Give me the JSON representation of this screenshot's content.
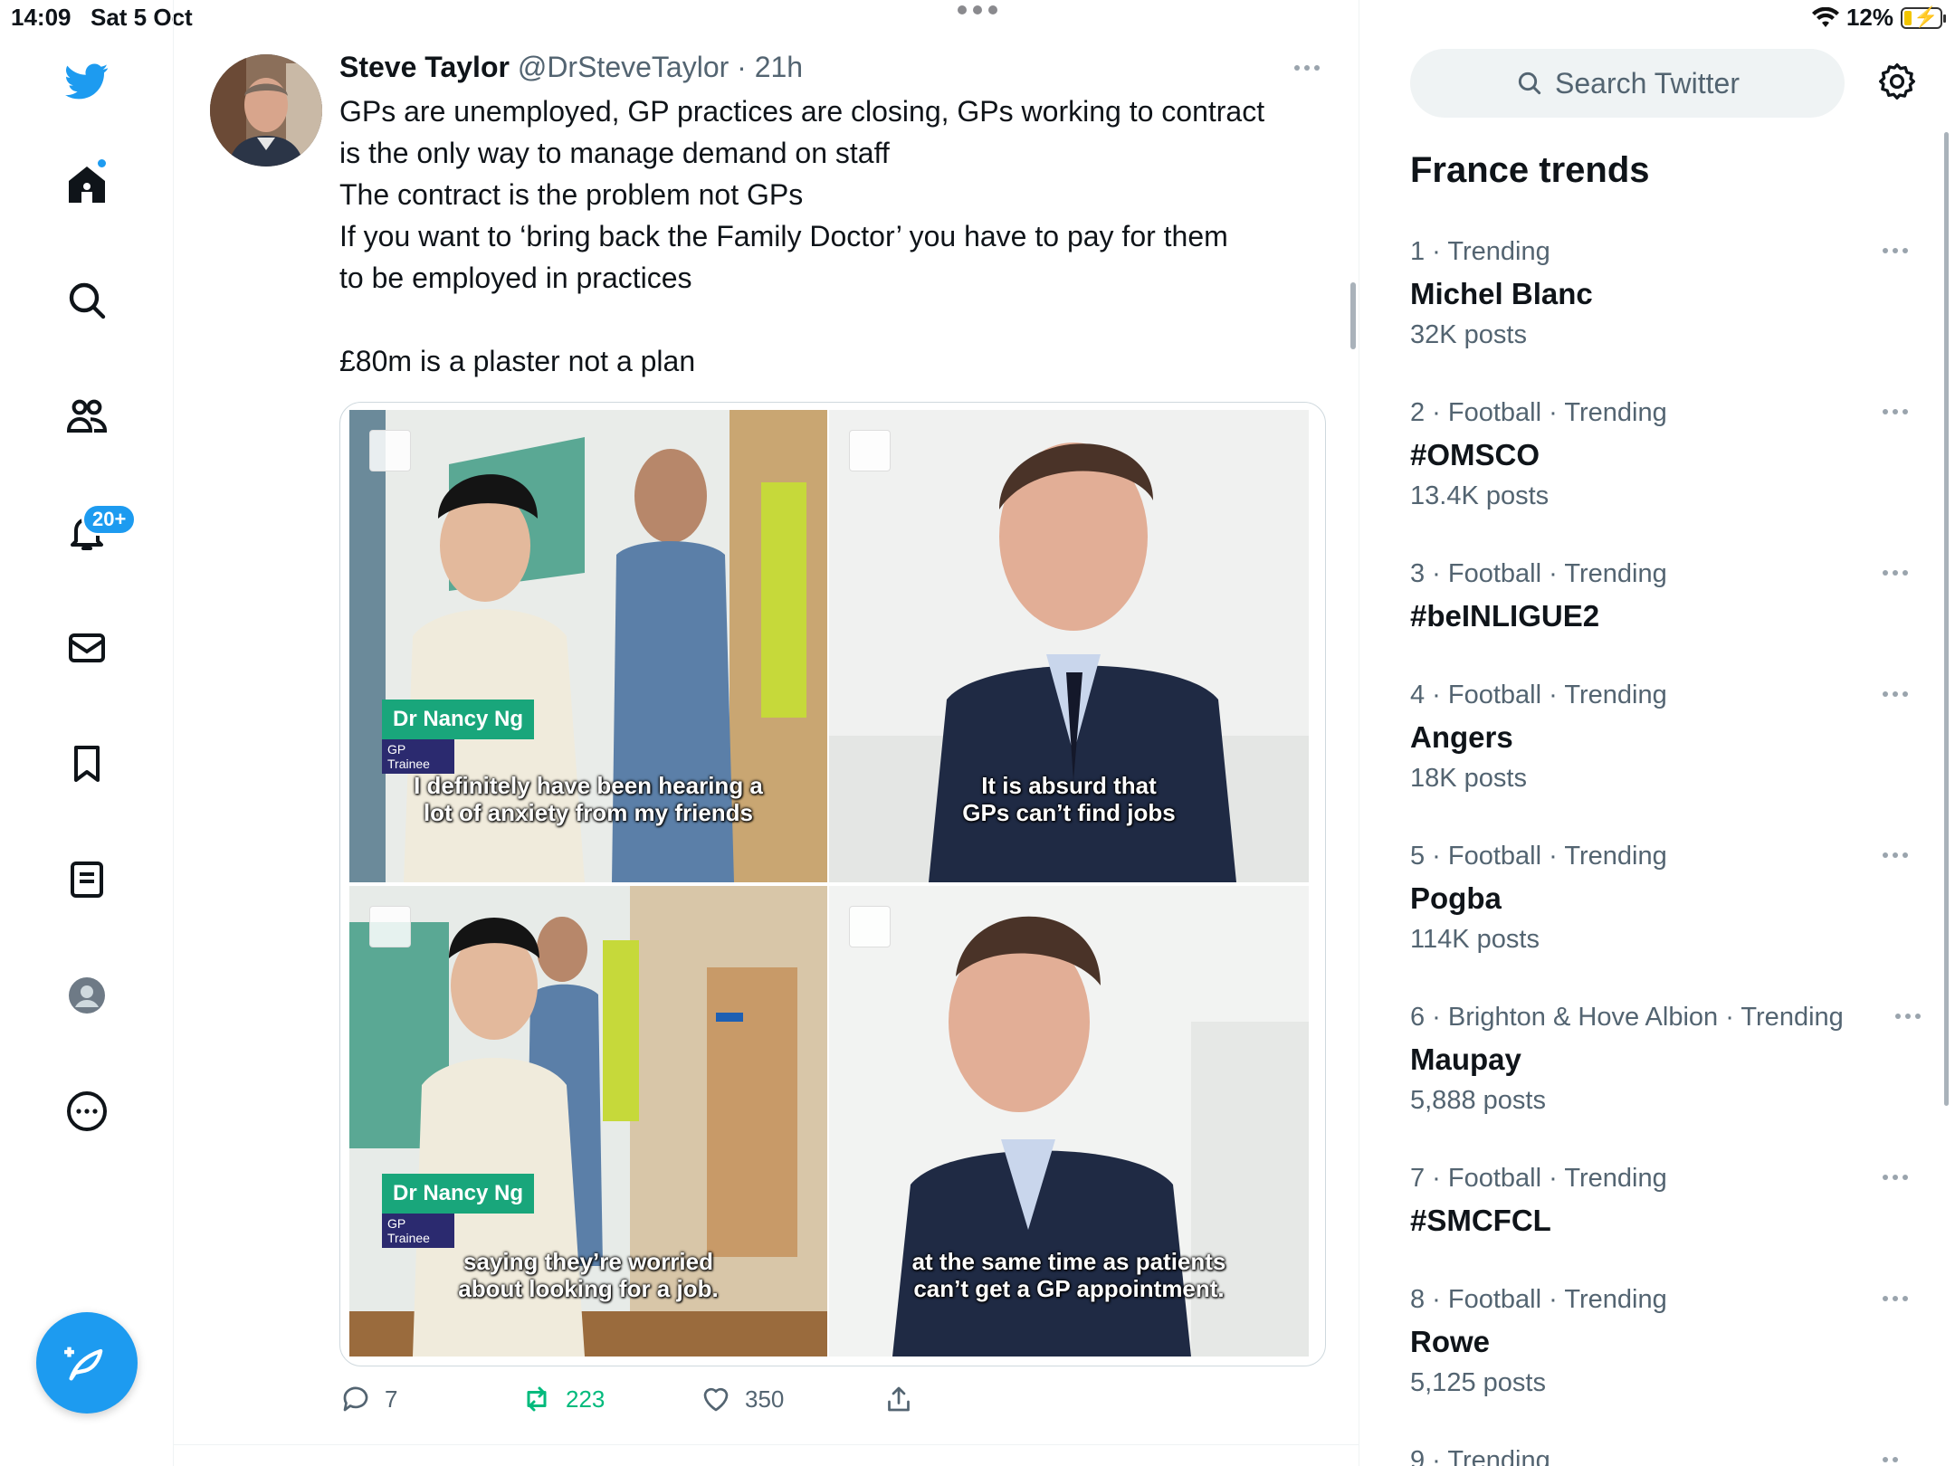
{
  "status_bar": {
    "time": "14:09",
    "date": "Sat 5 Oct",
    "battery": "12%"
  },
  "nav": {
    "notifications_badge": "20+"
  },
  "tweet": {
    "author_name": "Steve Taylor",
    "author_handle": "@DrSteveTaylor",
    "separator": "·",
    "time": "21h",
    "lines": [
      "GPs are unemployed, GP practices are closing, GPs working to contract",
      "is the only way to manage demand on staff",
      "The contract is the problem not GPs",
      "If you want to ‘bring back the Family Doctor’ you have to pay for them",
      "to be employed in practices",
      "",
      "£80m is a plaster not a plan"
    ],
    "media": {
      "tile1": {
        "name": "Dr Nancy Ng",
        "role": "GP Trainee",
        "caption_1": "I definitely have been hearing a",
        "caption_2": "lot of anxiety from my friends"
      },
      "tile2": {
        "caption_1": "It is absurd that",
        "caption_2": "GPs can’t  find jobs"
      },
      "tile3": {
        "name": "Dr Nancy Ng",
        "role": "GP Trainee",
        "caption_1": "saying they’re worried",
        "caption_2": "about looking for a job."
      },
      "tile4": {
        "caption_1": "at the same time as patients",
        "caption_2": "can’t get a GP appointment."
      }
    },
    "stats": {
      "replies": "7",
      "retweets": "223",
      "likes": "350"
    }
  },
  "sidebar": {
    "search_placeholder": "Search Twitter",
    "trends_title": "France trends",
    "trends": [
      {
        "meta": "1 · Trending",
        "name": "Michel Blanc",
        "posts": "32K posts"
      },
      {
        "meta": "2 · Football · Trending",
        "name": "#OMSCO",
        "posts": "13.4K posts"
      },
      {
        "meta": "3 · Football · Trending",
        "name": "#beINLIGUE2",
        "posts": ""
      },
      {
        "meta": "4 · Football · Trending",
        "name": "Angers",
        "posts": "18K posts"
      },
      {
        "meta": "5 · Football · Trending",
        "name": "Pogba",
        "posts": "114K posts"
      },
      {
        "meta": "6 · Brighton & Hove Albion · Trending",
        "name": "Maupay",
        "posts": "5,888 posts"
      },
      {
        "meta": "7 · Football · Trending",
        "name": "#SMCFCL",
        "posts": ""
      },
      {
        "meta": "8 · Football · Trending",
        "name": "Rowe",
        "posts": "5,125 posts"
      },
      {
        "meta": "9 · Trending",
        "name": "",
        "posts": ""
      }
    ]
  },
  "colors": {
    "accent": "#1d9bf0",
    "retweet_green": "#00ba7c",
    "secondary_text": "#536471"
  }
}
